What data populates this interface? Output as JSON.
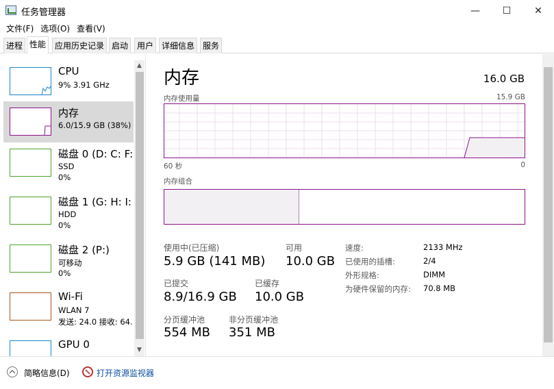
{
  "window": {
    "title": "任务管理器",
    "minimize_glyph": "—",
    "maximize_glyph": "☐",
    "close_glyph": "✕"
  },
  "menu": [
    "文件(F)",
    "选项(O)",
    "查看(V)"
  ],
  "tabs": [
    {
      "label": "进程",
      "active": false
    },
    {
      "label": "性能",
      "active": true
    },
    {
      "label": "应用历史记录",
      "active": false
    },
    {
      "label": "启动",
      "active": false
    },
    {
      "label": "用户",
      "active": false
    },
    {
      "label": "详细信息",
      "active": false
    },
    {
      "label": "服务",
      "active": false
    }
  ],
  "sidebar": {
    "items": [
      {
        "name": "CPU",
        "sub1": "9%  3.91 GHz",
        "sub2": "",
        "color": "#1a86c8",
        "selected": false
      },
      {
        "name": "内存",
        "sub1": "6.0/15.9 GB (38%)",
        "sub2": "",
        "color": "#8b128b",
        "selected": true
      },
      {
        "name": "磁盘 0 (D: C: F:",
        "sub1": "SSD",
        "sub2": "0%",
        "color": "#4da22f",
        "selected": false
      },
      {
        "name": "磁盘 1 (G: H: I:",
        "sub1": "HDD",
        "sub2": "0%",
        "color": "#4da22f",
        "selected": false
      },
      {
        "name": "磁盘 2 (P:)",
        "sub1": "可移动",
        "sub2": "0%",
        "color": "#4da22f",
        "selected": false
      },
      {
        "name": "Wi-Fi",
        "sub1": "WLAN 7",
        "sub2": "发送: 24.0  接收: 64.",
        "color": "#a7581e",
        "selected": false
      },
      {
        "name": "GPU 0",
        "sub1": "",
        "sub2": "",
        "color": "#1a86c8",
        "selected": false
      }
    ],
    "scroll_up": "▲",
    "scroll_down": "▼"
  },
  "main": {
    "title": "内存",
    "total": "16.0 GB",
    "usage_label": "内存使用量",
    "usage_max": "15.9 GB",
    "time_left": "60 秒",
    "time_right": "0",
    "composition_label": "内存组合",
    "stats": {
      "in_use_label": "使用中(已压缩)",
      "in_use_value": "5.9 GB (141 MB)",
      "available_label": "可用",
      "available_value": "10.0 GB",
      "committed_label": "已提交",
      "committed_value": "8.9/16.9 GB",
      "cached_label": "已缓存",
      "cached_value": "10.0 GB",
      "paged_label": "分页缓冲池",
      "paged_value": "554 MB",
      "nonpaged_label": "非分页缓冲池",
      "nonpaged_value": "351 MB"
    },
    "specs": [
      {
        "label": "速度:",
        "value": "2133 MHz"
      },
      {
        "label": "已使用的插槽:",
        "value": "2/4"
      },
      {
        "label": "外形规格:",
        "value": "DIMM"
      },
      {
        "label": "为硬件保留的内存:",
        "value": "70.8 MB"
      }
    ],
    "usage_fraction_current": 0.38,
    "composition_used_fraction": 0.37
  },
  "footer": {
    "fewer_details": "简略信息(D)",
    "open_monitor": "打开资源监视器"
  },
  "colors": {
    "memory_accent": "#8b128b",
    "memory_fill": "#f3f0f4"
  }
}
